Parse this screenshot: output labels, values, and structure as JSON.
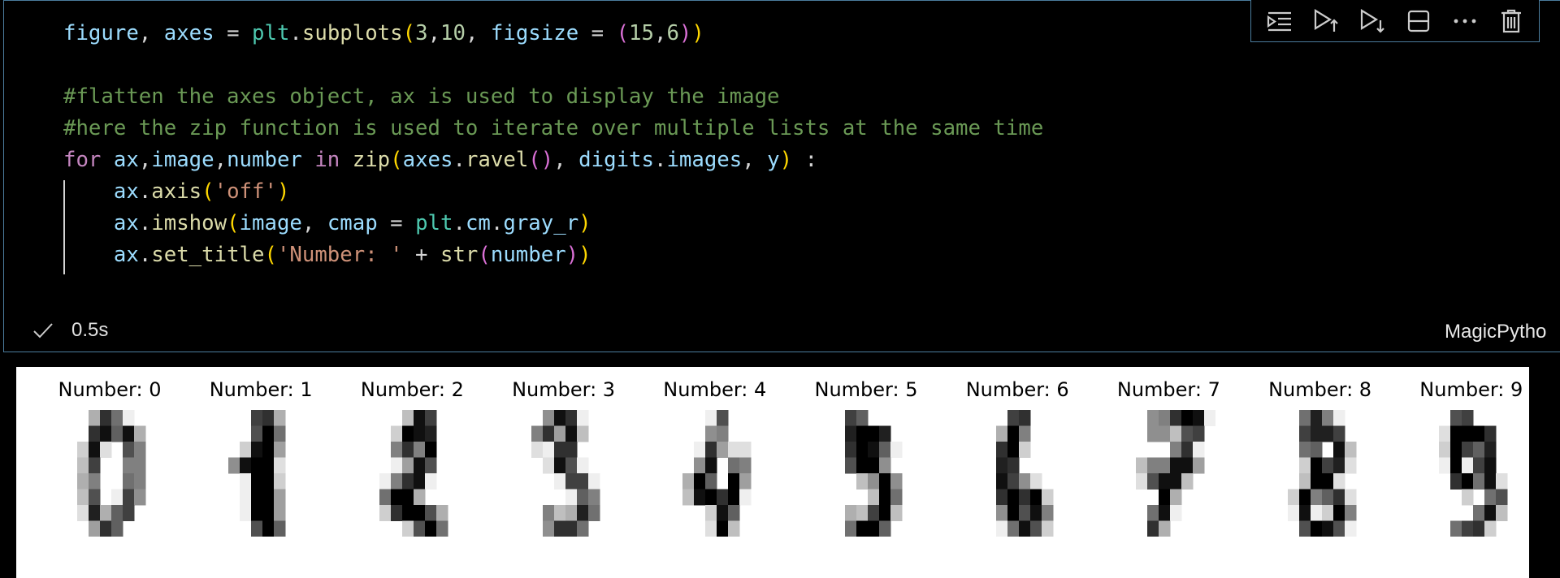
{
  "cell": {
    "code_lines": [
      [
        [
          "figure",
          "ident"
        ],
        [
          ", ",
          "punc"
        ],
        [
          "axes",
          "ident"
        ],
        [
          " = ",
          "punc"
        ],
        [
          "plt",
          "module"
        ],
        [
          ".",
          "punc"
        ],
        [
          "subplots",
          "func"
        ],
        [
          "(",
          "brack1"
        ],
        [
          "3",
          "number"
        ],
        [
          ",",
          "punc"
        ],
        [
          "10",
          "number"
        ],
        [
          ", ",
          "punc"
        ],
        [
          "figsize",
          "ident"
        ],
        [
          " = ",
          "punc"
        ],
        [
          "(",
          "brack2"
        ],
        [
          "15",
          "number"
        ],
        [
          ",",
          "punc"
        ],
        [
          "6",
          "number"
        ],
        [
          ")",
          "brack2"
        ],
        [
          ")",
          "brack1"
        ]
      ],
      [],
      [
        [
          "#flatten the axes object, ax is used to display the image",
          "comment"
        ]
      ],
      [
        [
          "#here the zip function is used to iterate over multiple lists at the same time",
          "comment"
        ]
      ],
      [
        [
          "for ",
          "keyword"
        ],
        [
          "ax",
          "ident"
        ],
        [
          ",",
          "punc"
        ],
        [
          "image",
          "ident"
        ],
        [
          ",",
          "punc"
        ],
        [
          "number",
          "ident"
        ],
        [
          " in ",
          "keyword"
        ],
        [
          "zip",
          "func"
        ],
        [
          "(",
          "brack1"
        ],
        [
          "axes",
          "ident"
        ],
        [
          ".",
          "punc"
        ],
        [
          "ravel",
          "func"
        ],
        [
          "()",
          "brack2"
        ],
        [
          ", ",
          "punc"
        ],
        [
          "digits",
          "ident"
        ],
        [
          ".",
          "punc"
        ],
        [
          "images",
          "ident"
        ],
        [
          ", ",
          "punc"
        ],
        [
          "y",
          "ident"
        ],
        [
          ")",
          "brack1"
        ],
        [
          " :",
          "punc"
        ]
      ],
      [
        [
          "    ",
          "punc"
        ],
        [
          "ax",
          "ident"
        ],
        [
          ".",
          "punc"
        ],
        [
          "axis",
          "func"
        ],
        [
          "(",
          "brack1"
        ],
        [
          "'off'",
          "string"
        ],
        [
          ")",
          "brack1"
        ]
      ],
      [
        [
          "    ",
          "punc"
        ],
        [
          "ax",
          "ident"
        ],
        [
          ".",
          "punc"
        ],
        [
          "imshow",
          "func"
        ],
        [
          "(",
          "brack1"
        ],
        [
          "image",
          "ident"
        ],
        [
          ", ",
          "punc"
        ],
        [
          "cmap",
          "ident"
        ],
        [
          " = ",
          "punc"
        ],
        [
          "plt",
          "module"
        ],
        [
          ".",
          "punc"
        ],
        [
          "cm",
          "ident"
        ],
        [
          ".",
          "punc"
        ],
        [
          "gray_r",
          "ident"
        ],
        [
          ")",
          "brack1"
        ]
      ],
      [
        [
          "    ",
          "punc"
        ],
        [
          "ax",
          "ident"
        ],
        [
          ".",
          "punc"
        ],
        [
          "set_title",
          "func"
        ],
        [
          "(",
          "brack1"
        ],
        [
          "'Number: '",
          "string"
        ],
        [
          " + ",
          "punc"
        ],
        [
          "str",
          "func"
        ],
        [
          "(",
          "brack2"
        ],
        [
          "number",
          "ident"
        ],
        [
          ")",
          "brack2"
        ],
        [
          ")",
          "brack1"
        ]
      ]
    ],
    "status": {
      "check_icon": "check-icon",
      "time": "0.5s"
    },
    "language": "MagicPytho",
    "toolbar": {
      "buttons": [
        {
          "name": "execute-above-cells-button",
          "icon": "run-above-icon"
        },
        {
          "name": "execute-cell-and-below-button",
          "icon": "run-below-icon"
        },
        {
          "name": "execute-cell-button",
          "icon": "run-cell-icon"
        },
        {
          "name": "split-cell-button",
          "icon": "split-cell-icon"
        },
        {
          "name": "more-actions-button",
          "icon": "ellipsis-icon"
        },
        {
          "name": "delete-cell-button",
          "icon": "trash-icon"
        }
      ]
    }
  },
  "output": {
    "titles": [
      "Number: 0",
      "Number: 1",
      "Number: 2",
      "Number: 3",
      "Number: 4",
      "Number: 5",
      "Number: 6",
      "Number: 7",
      "Number: 8",
      "Number: 9"
    ],
    "digits": [
      [
        [
          0,
          0,
          5,
          13,
          9,
          1,
          0,
          0
        ],
        [
          0,
          0,
          13,
          15,
          10,
          15,
          5,
          0
        ],
        [
          0,
          3,
          15,
          2,
          0,
          11,
          8,
          0
        ],
        [
          0,
          4,
          12,
          0,
          0,
          8,
          8,
          0
        ],
        [
          0,
          5,
          8,
          0,
          0,
          9,
          8,
          0
        ],
        [
          0,
          4,
          11,
          0,
          1,
          12,
          7,
          0
        ],
        [
          0,
          2,
          14,
          5,
          10,
          12,
          0,
          0
        ],
        [
          0,
          0,
          6,
          13,
          10,
          0,
          0,
          0
        ]
      ],
      [
        [
          0,
          0,
          0,
          12,
          13,
          5,
          0,
          0
        ],
        [
          0,
          0,
          0,
          11,
          16,
          9,
          0,
          0
        ],
        [
          0,
          0,
          3,
          15,
          16,
          6,
          0,
          0
        ],
        [
          0,
          7,
          15,
          16,
          16,
          2,
          0,
          0
        ],
        [
          0,
          0,
          1,
          16,
          16,
          3,
          0,
          0
        ],
        [
          0,
          0,
          1,
          16,
          16,
          6,
          0,
          0
        ],
        [
          0,
          0,
          1,
          16,
          16,
          6,
          0,
          0
        ],
        [
          0,
          0,
          0,
          11,
          16,
          10,
          0,
          0
        ]
      ],
      [
        [
          0,
          0,
          0,
          4,
          15,
          12,
          0,
          0
        ],
        [
          0,
          0,
          3,
          16,
          15,
          14,
          0,
          0
        ],
        [
          0,
          0,
          8,
          13,
          8,
          16,
          0,
          0
        ],
        [
          0,
          0,
          1,
          6,
          15,
          11,
          0,
          0
        ],
        [
          0,
          1,
          8,
          13,
          15,
          1,
          0,
          0
        ],
        [
          0,
          9,
          16,
          16,
          5,
          0,
          0,
          0
        ],
        [
          0,
          3,
          13,
          16,
          16,
          11,
          5,
          0
        ],
        [
          0,
          0,
          0,
          3,
          11,
          16,
          9,
          0
        ]
      ],
      [
        [
          0,
          0,
          7,
          15,
          13,
          1,
          0,
          0
        ],
        [
          0,
          8,
          13,
          6,
          15,
          4,
          0,
          0
        ],
        [
          0,
          2,
          1,
          13,
          13,
          0,
          0,
          0
        ],
        [
          0,
          0,
          2,
          15,
          11,
          1,
          0,
          0
        ],
        [
          0,
          0,
          0,
          1,
          12,
          12,
          1,
          0
        ],
        [
          0,
          0,
          0,
          0,
          1,
          10,
          8,
          0
        ],
        [
          0,
          0,
          8,
          4,
          5,
          14,
          9,
          0
        ],
        [
          0,
          0,
          7,
          13,
          13,
          9,
          0,
          0
        ]
      ],
      [
        [
          0,
          0,
          0,
          1,
          11,
          0,
          0,
          0
        ],
        [
          0,
          0,
          0,
          7,
          8,
          0,
          0,
          0
        ],
        [
          0,
          0,
          1,
          13,
          6,
          2,
          2,
          0
        ],
        [
          0,
          0,
          7,
          15,
          0,
          9,
          8,
          0
        ],
        [
          0,
          5,
          16,
          10,
          0,
          16,
          6,
          0
        ],
        [
          0,
          4,
          15,
          16,
          13,
          16,
          1,
          0
        ],
        [
          0,
          0,
          0,
          3,
          15,
          10,
          0,
          0
        ],
        [
          0,
          0,
          0,
          2,
          16,
          4,
          0,
          0
        ]
      ],
      [
        [
          0,
          0,
          12,
          10,
          0,
          0,
          0,
          0
        ],
        [
          0,
          0,
          14,
          16,
          16,
          14,
          0,
          0
        ],
        [
          0,
          0,
          13,
          16,
          15,
          10,
          1,
          0
        ],
        [
          0,
          0,
          11,
          16,
          16,
          7,
          0,
          0
        ],
        [
          0,
          0,
          0,
          4,
          7,
          16,
          7,
          0
        ],
        [
          0,
          0,
          0,
          0,
          4,
          16,
          9,
          0
        ],
        [
          0,
          0,
          5,
          4,
          12,
          16,
          4,
          0
        ],
        [
          0,
          0,
          9,
          16,
          16,
          10,
          0,
          0
        ]
      ],
      [
        [
          0,
          0,
          0,
          12,
          13,
          0,
          0,
          0
        ],
        [
          0,
          0,
          5,
          16,
          8,
          0,
          0,
          0
        ],
        [
          0,
          0,
          13,
          16,
          3,
          0,
          0,
          0
        ],
        [
          0,
          0,
          14,
          13,
          0,
          0,
          0,
          0
        ],
        [
          0,
          0,
          15,
          12,
          7,
          2,
          0,
          0
        ],
        [
          0,
          0,
          13,
          16,
          13,
          16,
          3,
          0
        ],
        [
          0,
          0,
          7,
          16,
          11,
          15,
          8,
          0
        ],
        [
          0,
          0,
          1,
          9,
          15,
          11,
          3,
          0
        ]
      ],
      [
        [
          0,
          0,
          7,
          8,
          13,
          16,
          15,
          1
        ],
        [
          0,
          0,
          7,
          7,
          4,
          11,
          12,
          0
        ],
        [
          0,
          0,
          0,
          0,
          8,
          13,
          1,
          0
        ],
        [
          0,
          4,
          8,
          8,
          15,
          15,
          6,
          0
        ],
        [
          0,
          2,
          11,
          15,
          15,
          4,
          0,
          0
        ],
        [
          0,
          0,
          0,
          16,
          5,
          0,
          0,
          0
        ],
        [
          0,
          0,
          9,
          15,
          1,
          0,
          0,
          0
        ],
        [
          0,
          0,
          13,
          5,
          0,
          0,
          0,
          0
        ]
      ],
      [
        [
          0,
          0,
          9,
          14,
          8,
          1,
          0,
          0
        ],
        [
          0,
          0,
          12,
          14,
          14,
          12,
          0,
          0
        ],
        [
          0,
          0,
          9,
          10,
          0,
          15,
          4,
          0
        ],
        [
          0,
          0,
          3,
          16,
          12,
          14,
          2,
          0
        ],
        [
          0,
          0,
          4,
          16,
          16,
          2,
          0,
          0
        ],
        [
          0,
          3,
          16,
          8,
          10,
          13,
          2,
          0
        ],
        [
          0,
          1,
          15,
          1,
          3,
          16,
          8,
          0
        ],
        [
          0,
          0,
          11,
          16,
          15,
          11,
          1,
          0
        ]
      ],
      [
        [
          0,
          0,
          11,
          12,
          0,
          0,
          0,
          0
        ],
        [
          0,
          2,
          16,
          16,
          16,
          13,
          0,
          0
        ],
        [
          0,
          3,
          16,
          12,
          10,
          14,
          0,
          0
        ],
        [
          0,
          1,
          16,
          1,
          12,
          15,
          0,
          0
        ],
        [
          0,
          0,
          13,
          16,
          9,
          15,
          2,
          0
        ],
        [
          0,
          0,
          0,
          3,
          0,
          9,
          11,
          0
        ],
        [
          0,
          0,
          0,
          0,
          9,
          15,
          4,
          0
        ],
        [
          0,
          0,
          9,
          12,
          13,
          3,
          0,
          0
        ]
      ]
    ]
  }
}
